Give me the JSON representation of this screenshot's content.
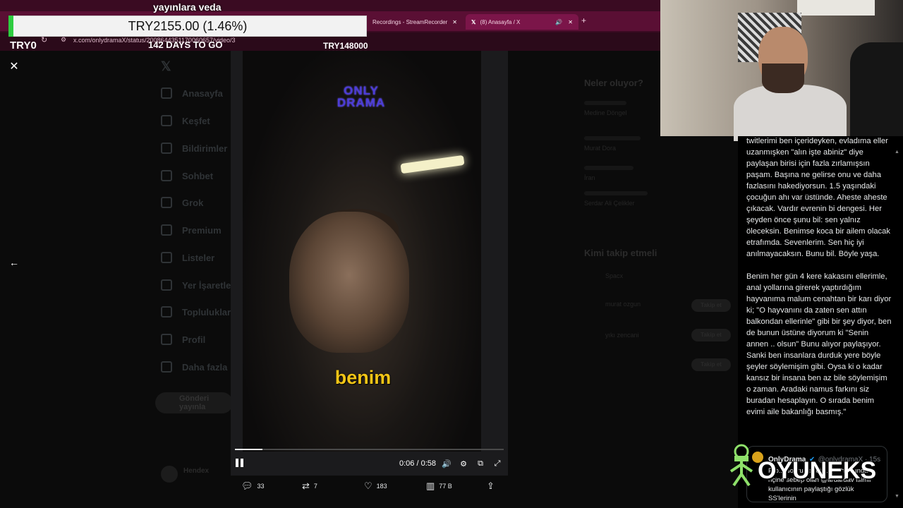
{
  "overlay": {
    "stream_title": "yayınlara veda",
    "goal_amount": "TRY2155.00 (1.46%)",
    "goal_progress_pct": 1.46,
    "goal_start": "TRY0",
    "goal_days": "142 DAYS TO GO",
    "goal_target": "TRY148000"
  },
  "browser": {
    "tabs": [
      {
        "label": "Recordings - StreamRecorder"
      },
      {
        "label": "(8) Anasayfa / X"
      }
    ],
    "url": "x.com/onlydramaX/status/2008644351170060657/video/3"
  },
  "sidebar": {
    "items": [
      "Anasayfa",
      "Keşfet",
      "Bildirimler",
      "Sohbet",
      "Grok",
      "Premium",
      "Listeler",
      "Yer İşaretleri",
      "Topluluklar",
      "Profil",
      "Daha fazla"
    ],
    "post_label": "Gönderi yayınla",
    "user_name": "Hendex"
  },
  "right_column": {
    "trending_title": "Neler oluyor?",
    "trend_1": "Medine Döngel",
    "trend_2": "Murat Dora",
    "trend_3": "İran",
    "trend_4": "Serdar Ali Çelikler",
    "who_to_follow": "Kimi takip etmeli",
    "follow_1": "Spacx",
    "follow_2": "murat ozgun",
    "follow_3": "yıkı zencani",
    "follow_label": "Takip et"
  },
  "video": {
    "logo_line1": "ONLY",
    "logo_line2": "DRAMA",
    "caption": "benim",
    "time": "0:06 / 0:58",
    "progress_fraction": 0.103
  },
  "actions": {
    "replies": "33",
    "reposts": "7",
    "likes": "183",
    "views": "77 B"
  },
  "tweet": {
    "text": "twitlerimi ben içerideyken, evladıma eller uzanmışken \"alın işte abiniz\" diye paylaşan birisi için fazla zırlamışsın paşam. Başına ne gelirse onu ve daha fazlasını hakediyorsun. 1.5 yaşındaki çocuğun ahı var üstünde. Aheste aheste çıkacak. Vardır evrenin bi dengesi. Her şeyden önce şunu bil: sen yalnız öleceksin. Benimse koca bir ailem olacak etrafımda. Sevenlerim. Sen hiç iyi anılmayacaksın. Bunu bil. Böyle yaşa.\n\nBenim her gün 4 kere kakasını ellerimle, anal yollarına girerek yaptırdığım hayvanıma malum cenahtan bir karı diyor ki; \"O hayvanını da zaten sen attın balkondan ellerinle\" gibi bir şey diyor, ben de bunun üstüne diyorum ki \"Senin annen .. olsun\" Bunu alıyor paylaşıyor. Sanki ben insanlara durduk yere böyle şeyler söylemişim gibi. Oysa ki o kadar kansız bir insana ben az bile söylemişim o zaman. Aradaki namus farkını siz buradan hesaplayın. O sırada benim evimi aile bakanlığı basmış.\"",
    "quote_name": "OnlyDrama",
    "quote_handle": "@onlydramaX · 15s",
    "quote_body": "Pro... doğru kendisi... ... hakkında ... nçine sebep olan @ardardav isimli kullanıcının paylaştığı gözlük SS'lerinin"
  },
  "brand": {
    "name": "OYUNEKS"
  },
  "colors": {
    "chrome": "#5a0f34",
    "caption": "#f2c516",
    "goal_fill": "#2ecc40"
  }
}
